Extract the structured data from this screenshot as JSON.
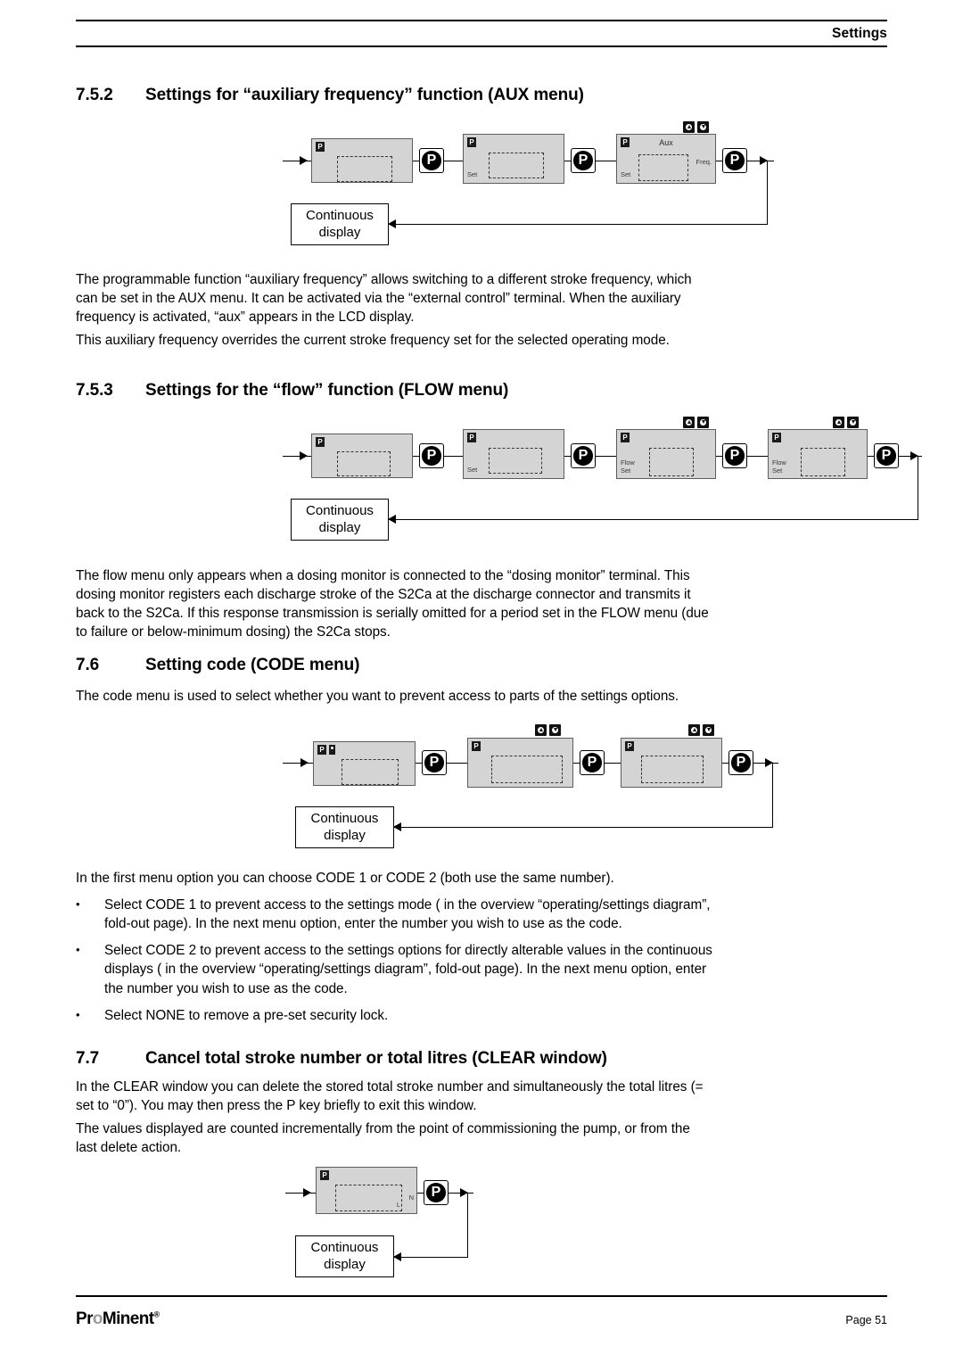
{
  "header": {
    "title": "Settings"
  },
  "sections": {
    "aux": {
      "number": "7.5.2",
      "title": "Settings for “auxiliary frequency” function (AUX menu)",
      "paragraphs": [
        "The programmable function “auxiliary frequency” allows switching to a different stroke frequency, which can be set in the AUX menu. It can be activated via the “external control” terminal. When the auxiliary frequency is activated, “aux” appears in the LCD display.",
        "This auxiliary frequency overrides the current stroke frequency set for the selected operating mode."
      ]
    },
    "flow": {
      "number": "7.5.3",
      "title": "Settings for the “flow” function (FLOW menu)",
      "paragraphs": [
        "The flow menu only appears when a dosing monitor is connected to the “dosing monitor” terminal. This dosing monitor registers each discharge stroke of the S2Ca at the discharge connector and transmits it back to the S2Ca. If this response transmission is serially omitted for a period set in the FLOW menu (due to failure or below-minimum dosing) the S2Ca stops."
      ]
    },
    "code": {
      "number": "7.6",
      "title": "Setting code (CODE menu)",
      "intro": "The code menu is used to select whether you want to prevent access to parts of the settings options.",
      "after_diagram": "In the first menu option you can choose CODE 1 or CODE 2 (both use the same number).",
      "bullet_marker": "•",
      "bullets": [
        "Select CODE 1 to prevent access to the settings mode (    in the overview “operating/settings diagram”, fold-out page). In the next menu option, enter the number you wish to use as the code.",
        "Select CODE 2 to prevent access to the settings options for directly alterable values in the continuous displays (    in the overview “operating/settings diagram”, fold-out page). In the next menu option, enter the number you wish to use as the code.",
        "Select NONE to remove a pre-set security lock."
      ]
    },
    "clear": {
      "number": "7.7",
      "title": "Cancel total stroke number or total litres (CLEAR window)",
      "paragraphs": [
        "In the CLEAR window you can delete the stored total stroke number and simultaneously the total litres (= set to “0”). You may then press the P key briefly to exit this window.",
        "The values displayed are counted incrementally from the point of commissioning the pump, or from the last delete action."
      ]
    }
  },
  "diagrams": {
    "aux": {
      "continuous_display_line1": "Continuous",
      "continuous_display_line2": "display",
      "pkey_label": "P",
      "panels": [
        {
          "badge": "P",
          "top_label": "",
          "bottom_labels": [],
          "right_label": ""
        },
        {
          "badge": "P",
          "top_label": "",
          "bottom_labels": [
            "Set"
          ],
          "right_label": ""
        },
        {
          "badge": "P",
          "top_label": "Aux",
          "bottom_labels": [
            "Set"
          ],
          "right_label": "Freq."
        }
      ]
    },
    "flow": {
      "continuous_display_line1": "Continuous",
      "continuous_display_line2": "display",
      "pkey_label": "P",
      "panels": [
        {
          "badge": "P",
          "top_label": "",
          "bottom_labels": [],
          "right_label": ""
        },
        {
          "badge": "P",
          "top_label": "",
          "bottom_labels": [
            "Set"
          ],
          "right_label": ""
        },
        {
          "badge": "P",
          "top_label": "",
          "bottom_labels": [
            "Flow",
            "Set"
          ],
          "right_label": ""
        },
        {
          "badge": "P",
          "top_label": "",
          "bottom_labels": [
            "Flow",
            "Set"
          ],
          "right_label": ""
        }
      ]
    },
    "code": {
      "continuous_display_line1": "Continuous",
      "continuous_display_line2": "display",
      "pkey_label": "P",
      "panels": [
        {
          "badge": "P",
          "has_lock": true,
          "top_label": "",
          "bottom_labels": [],
          "right_label": ""
        },
        {
          "badge": "P",
          "top_label": "",
          "bottom_labels": [],
          "right_label": ""
        },
        {
          "badge": "P",
          "top_label": "",
          "bottom_labels": [],
          "right_label": ""
        }
      ]
    },
    "clear": {
      "continuous_display_line1": "Continuous",
      "continuous_display_line2": "display",
      "pkey_label": "P",
      "panels": [
        {
          "badge": "P",
          "top_label": "",
          "bottom_labels": [],
          "right_label": "N",
          "inner_label": "L"
        }
      ]
    }
  },
  "footer": {
    "logo_pre": "Pr",
    "logo_o": "o",
    "logo_post": "Minent",
    "logo_reg": "®",
    "page": "Page 51"
  },
  "colors": {
    "panel_fill": "#d4d4d4",
    "panel_border": "#5d5d5d",
    "ink": "#000000",
    "logo_accent": "#9a9a9a"
  }
}
